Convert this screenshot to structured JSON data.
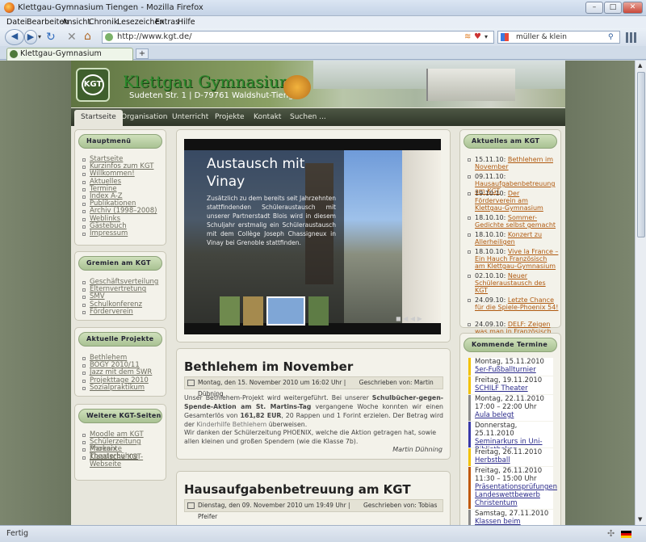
{
  "browser": {
    "window_title": "Klettgau-Gymnasium Tiengen - Mozilla Firefox",
    "menu": [
      "Datei",
      "Bearbeiten",
      "Ansicht",
      "Chronik",
      "Lesezeichen",
      "Extras",
      "Hilfe"
    ],
    "url": "http://www.kgt.de/",
    "search_value": "müller & klein",
    "tab_label": "Klettgau-Gymnasium Tiengen",
    "status_text": "Fertig"
  },
  "site": {
    "name": "Klettgau Gymnasium",
    "logo_text": "KGT",
    "address": "Sudeten Str. 1 | D-79761 Waldshut-Tiengen",
    "nav": [
      "Startseite",
      "Organisation",
      "Unterricht",
      "Projekte",
      "Kontakt",
      "Suchen ..."
    ]
  },
  "left": {
    "hauptmenu_title": "Hauptmenü",
    "hauptmenu": [
      "Startseite",
      "Kurzinfos zum KGT",
      "Willkommen!",
      "Aktuelles",
      "Termine",
      "Index A-Z",
      "Publikationen",
      "Archiv (1998–2008)",
      "Weblinks",
      "Gästebuch",
      "Impressum"
    ],
    "gremien_title": "Gremien am KGT",
    "gremien": [
      "Geschäftsverteilung",
      "Elternvertretung",
      "SMV",
      "Schulkonferenz",
      "Förderverein"
    ],
    "projekte_title": "Aktuelle Projekte",
    "projekte": [
      "Bethlehem",
      "BOGY 2010/11",
      "Jazz mit dem SWR",
      "Projekttage 2010",
      "Sozialpraktikum"
    ],
    "weitere_title": "Weitere KGT-Seiten",
    "weitere": [
      "Moodle am KGT",
      "Schülerzeitung Phoenix",
      "Markante Theaterbühne",
      "Klassische KGT-Webseite"
    ]
  },
  "slider": {
    "title": "Austausch mit Vinay",
    "text": "Zusätzlich zu dem bereits seit Jahrzehnten stattfindenden Schüleraustausch mit unserer Partnerstadt Blois wird in diesem Schuljahr erstmalig ein Schüleraustausch mit dem Collège Joseph Chassigneux in Vinay bei Grenoble stattfinden."
  },
  "articles": [
    {
      "title": "Bethlehem im November",
      "date": "Montag, den 15. November 2010 um 16:02 Uhr |",
      "author": "Geschrieben von: Martin Dühning",
      "p1": "Unser Bethlehem-Projekt wird weitergeführt. Bei unserer",
      "p1_bold": "Schulbücher-gegen-Spende-Aktion am St. Martins-Tag",
      "p1b": "vergangene Woche konnten wir einen Gesamterlös von",
      "p1_amount": "161,82 EUR",
      "p1c": ", 20 Rappen und 1 Forint erzielen. Der Betrag wird der",
      "p1_link": "Kinderhilfe Bethlehem",
      "p1d": "überweisen.",
      "p2": "Wir danken der Schülerzeitung PHOENIX, welche die Aktion getragen hat, sowie allen kleinen und großen Spendern (wie die Klasse 7b).",
      "sig": "Martin Dühning"
    },
    {
      "title": "Hausaufgabenbetreuung am KGT",
      "date": "Dienstag, den 09. November 2010 um 19:49 Uhr |",
      "author": "Geschrieben von: Tobias Pfeifer"
    }
  ],
  "right": {
    "aktuelles_title": "Aktuelles am KGT",
    "aktuelles": [
      {
        "d": "15.11.10:",
        "t": "Bethlehem im November"
      },
      {
        "d": "09.11.10:",
        "t": "Hausaufgabenbetreuung am KGT"
      },
      {
        "d": "19.10.10:",
        "t": "Der Förderverein am Klettgau-Gymnasium"
      },
      {
        "d": "18.10.10:",
        "t": "Sommer-Gedichte selbst gemacht"
      },
      {
        "d": "18.10.10:",
        "t": "Konzert zu Allerheiligen"
      },
      {
        "d": "18.10.10:",
        "t": "Vive la France – Ein Hauch Französisch am Klettgau-Gymnasium"
      },
      {
        "d": "02.10.10:",
        "t": "Neuer Schüleraustausch des KGT"
      },
      {
        "d": "24.09.10:",
        "t": "Letzte Chance für die Spiele-Phoenix 54!"
      },
      {
        "d": "24.09.10:",
        "t": "DELF: Zeigen was man in Französisch drauf hat"
      }
    ],
    "termine_title": "Kommende Termine",
    "termine": [
      {
        "d": "Montag, 15.11.2010",
        "t": "5er-Fußballturnier"
      },
      {
        "d": "Freitag, 19.11.2010",
        "t": "SCHILF Theater"
      },
      {
        "d": "Montag, 22.11.2010",
        "s": "17:00 – 22:00 Uhr",
        "t": "Aula belegt"
      },
      {
        "d": "Donnerstag, 25.11.2010",
        "t": "Seminarkurs in Uni-Bibliotheken"
      },
      {
        "d": "Freitag, 26.11.2010",
        "t": "Herbstball"
      },
      {
        "d": "Freitag, 26.11.2010",
        "s": "11:30 – 15:00 Uhr",
        "t": "Präsentationsprüfungen Landeswettbewerb Christentum"
      },
      {
        "d": "Samstag, 27.11.2010",
        "t": "Klassen beim Tiengener Adventsmarkt"
      }
    ]
  }
}
